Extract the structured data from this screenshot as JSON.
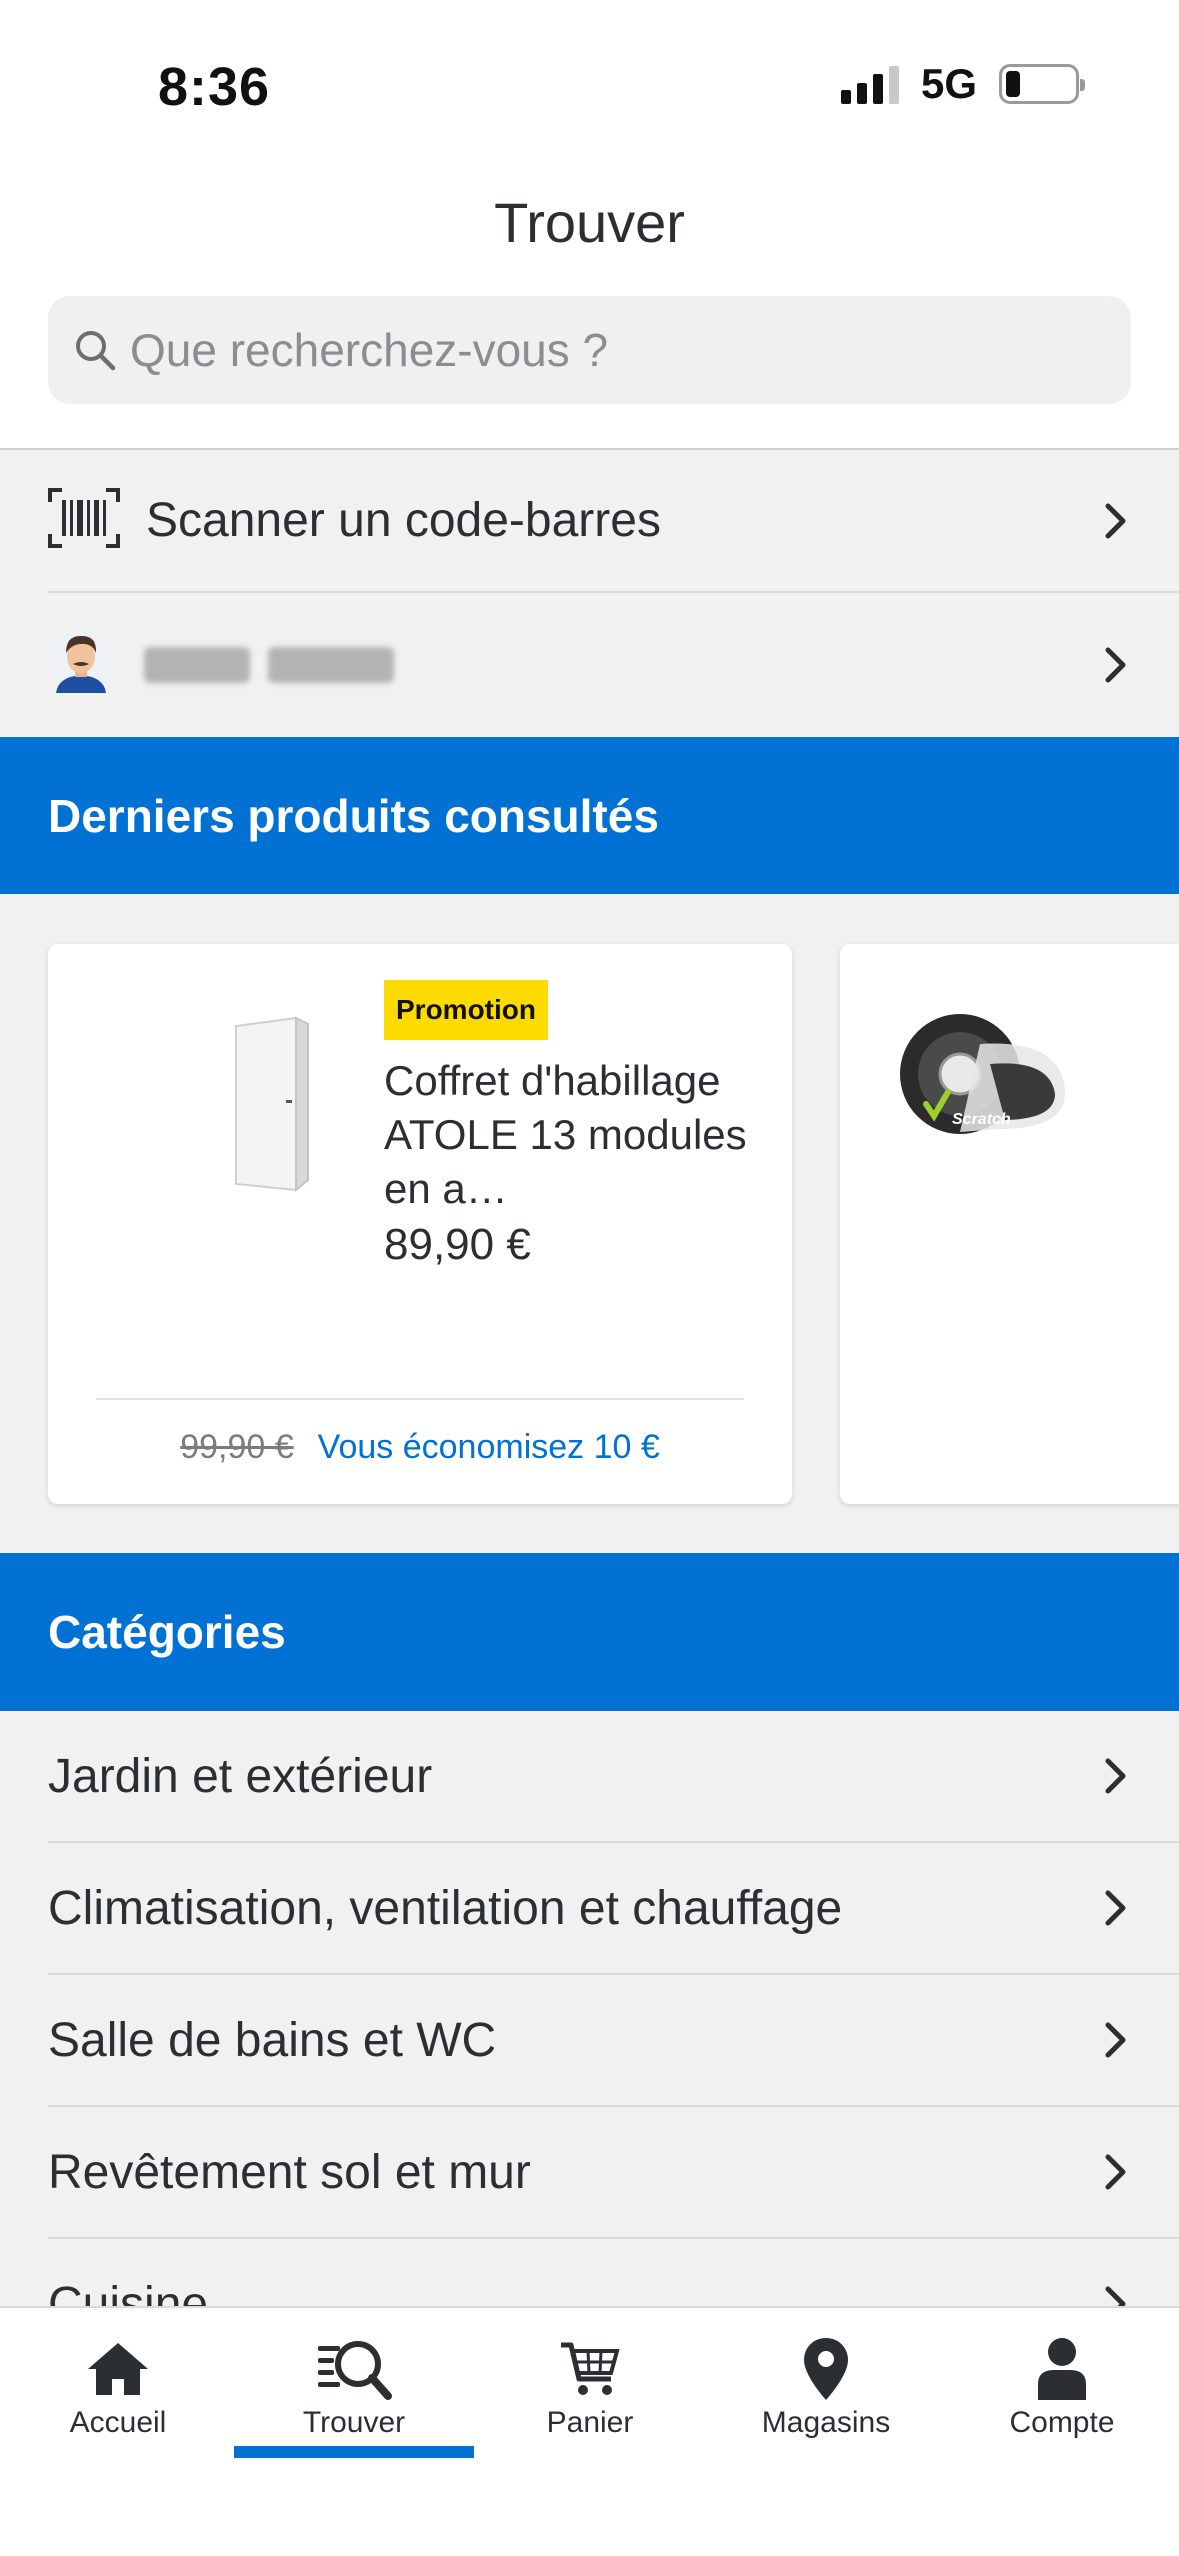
{
  "status_bar": {
    "time": "8:36",
    "network": "5G"
  },
  "header": {
    "title": "Trouver"
  },
  "search": {
    "placeholder": "Que recherchez-vous ?"
  },
  "quick_actions": [
    {
      "label": "Scanner un code-barres",
      "icon": "barcode-scan-icon"
    },
    {
      "label": "",
      "icon": "avatar"
    }
  ],
  "recent": {
    "title": "Derniers produits consultés",
    "products": [
      {
        "badge": "Promotion",
        "name": "Coffret d'habillage ATOLE 13 modules en a…",
        "price": "89,90 €",
        "old_price": "99,90 €",
        "savings": "Vous économisez 10 €",
        "image": "white-cabinet"
      },
      {
        "image": "velcro-tape-roll"
      }
    ]
  },
  "categories": {
    "title": "Catégories",
    "items": [
      "Jardin et extérieur",
      "Climatisation, ventilation et chauffage",
      "Salle de bains et WC",
      "Revêtement sol et mur",
      "Cuisine"
    ]
  },
  "tab_bar": {
    "active": "Trouver",
    "tabs": [
      {
        "label": "Accueil",
        "icon": "home-icon"
      },
      {
        "label": "Trouver",
        "icon": "find-icon"
      },
      {
        "label": "Panier",
        "icon": "cart-icon"
      },
      {
        "label": "Magasins",
        "icon": "location-pin-icon"
      },
      {
        "label": "Compte",
        "icon": "user-icon"
      }
    ]
  },
  "colors": {
    "brand_blue": "#0172d4",
    "promo_yellow": "#fedb00",
    "background": "#f1f1f1"
  }
}
